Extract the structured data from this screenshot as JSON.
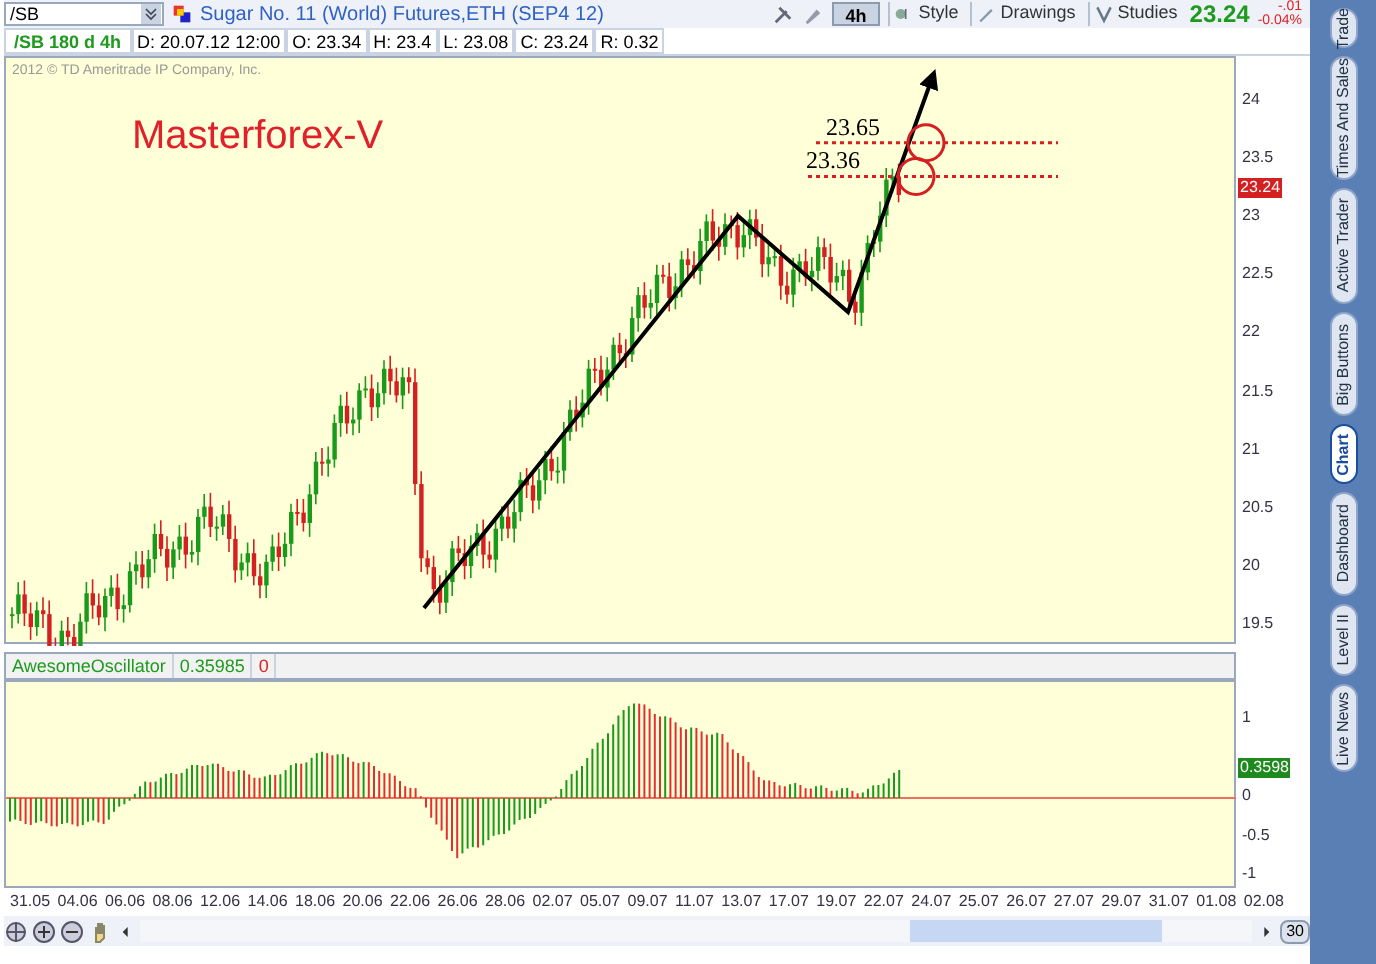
{
  "toolbar": {
    "symbol": "/SB",
    "instrument": "Sugar No. 11 (World)  Futures,ETH (SEP4 12)",
    "interval": "4h",
    "buttons": [
      "Style",
      "Drawings",
      "Studies"
    ],
    "last_price": "23.24",
    "change": "-.01",
    "change_pct": "-0.04%"
  },
  "info_bar": {
    "title": "/SB 180 d 4h",
    "fields": [
      "D: 20.07.12 12:00",
      "O: 23.34",
      "H: 23.4",
      "L: 23.08",
      "C: 23.24",
      "R: 0.32"
    ]
  },
  "price_pane": {
    "copyright": "2012 © TD Ameritrade IP Company, Inc.",
    "watermark_label": "Masterforex-V",
    "levels": [
      {
        "label": "23.65"
      },
      {
        "label": "23.36"
      }
    ],
    "price_axis": [
      "24",
      "23.5",
      "23",
      "22.5",
      "22",
      "21.5",
      "21",
      "20.5",
      "20",
      "19.5"
    ],
    "current_price": "23.24"
  },
  "oscillator_pane": {
    "name": "AwesomeOscillator",
    "value": "0.35985",
    "signal": "0",
    "axis": [
      "1",
      "0",
      "-0.5",
      "-1"
    ],
    "current_value": "0.3598"
  },
  "date_axis": [
    "31.05",
    "04.06",
    "06.06",
    "08.06",
    "12.06",
    "14.06",
    "18.06",
    "20.06",
    "22.06",
    "26.06",
    "28.06",
    "02.07",
    "05.07",
    "09.07",
    "11.07",
    "13.07",
    "17.07",
    "19.07",
    "22.07",
    "24.07",
    "25.07",
    "26.07",
    "27.07",
    "29.07",
    "31.07",
    "01.08",
    "02.08"
  ],
  "bottom_bar": {
    "period": "30"
  },
  "side_tabs": [
    {
      "label": "Trade",
      "selected": false
    },
    {
      "label": "Times And Sales",
      "selected": false
    },
    {
      "label": "Active Trader",
      "selected": false
    },
    {
      "label": "Big Buttons",
      "selected": false
    },
    {
      "label": "Chart",
      "selected": true
    },
    {
      "label": "Dashboard",
      "selected": false
    },
    {
      "label": "Level II",
      "selected": false
    },
    {
      "label": "Live News",
      "selected": false
    }
  ]
}
